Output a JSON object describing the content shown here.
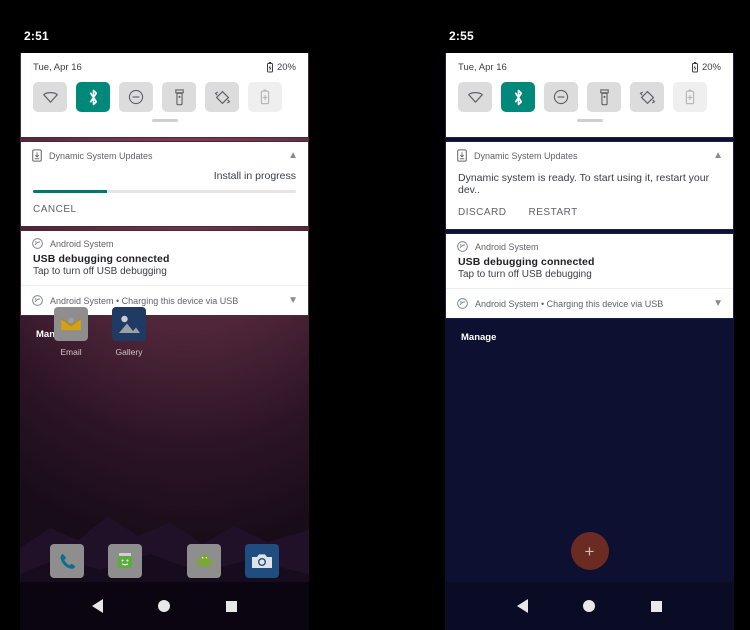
{
  "left": {
    "status": {
      "clock": "2:51"
    },
    "quick_settings": {
      "date": "Tue, Apr 16",
      "battery_percent": "20%",
      "battery_icon": "battery-icon",
      "tiles": [
        {
          "name": "wifi-tile",
          "icon": "wifi-icon",
          "state": "off"
        },
        {
          "name": "bluetooth-tile",
          "icon": "bluetooth-icon",
          "state": "on"
        },
        {
          "name": "do-not-disturb-tile",
          "icon": "dnd-icon",
          "state": "off"
        },
        {
          "name": "flashlight-tile",
          "icon": "flashlight-icon",
          "state": "off"
        },
        {
          "name": "auto-rotate-tile",
          "icon": "auto-rotate-icon",
          "state": "off"
        },
        {
          "name": "battery-saver-tile",
          "icon": "battery-saver-icon",
          "state": "disabled"
        }
      ]
    },
    "notifications": {
      "dsu": {
        "app": "Dynamic System Updates",
        "app_icon": "system-update-icon",
        "status_text": "Install in progress",
        "progress_percent": 28,
        "progress_color": "#00796b",
        "action_cancel": "CANCEL",
        "caret": "collapse-icon"
      },
      "usb_debug": {
        "app": "Android System",
        "app_icon": "android-system-icon",
        "title": "USB debugging connected",
        "text": "Tap to turn off USB debugging"
      },
      "charging": {
        "summary": "Android System • Charging this device via USB",
        "app_icon": "android-system-icon",
        "caret": "expand-icon"
      }
    },
    "manage_label": "Manage",
    "home": {
      "apps": [
        {
          "label": "Email",
          "icon": "email-icon"
        },
        {
          "label": "Gallery",
          "icon": "gallery-icon"
        }
      ],
      "dock": [
        {
          "label": "Phone",
          "icon": "phone-icon"
        },
        {
          "label": "Messages",
          "icon": "messages-icon"
        },
        {
          "label": "Android",
          "icon": "android-icon"
        },
        {
          "label": "Camera",
          "icon": "camera-icon"
        }
      ]
    },
    "navbar": {
      "back": "back-icon",
      "home": "home-icon",
      "recents": "recents-icon"
    }
  },
  "right": {
    "status": {
      "clock": "2:55"
    },
    "quick_settings": {
      "date": "Tue, Apr 16",
      "battery_percent": "20%",
      "battery_icon": "battery-icon",
      "tiles": [
        {
          "name": "wifi-tile",
          "icon": "wifi-icon",
          "state": "off"
        },
        {
          "name": "bluetooth-tile",
          "icon": "bluetooth-icon",
          "state": "on"
        },
        {
          "name": "do-not-disturb-tile",
          "icon": "dnd-icon",
          "state": "off"
        },
        {
          "name": "flashlight-tile",
          "icon": "flashlight-icon",
          "state": "off"
        },
        {
          "name": "auto-rotate-tile",
          "icon": "auto-rotate-icon",
          "state": "off"
        },
        {
          "name": "battery-saver-tile",
          "icon": "battery-saver-icon",
          "state": "disabled"
        }
      ]
    },
    "notifications": {
      "dsu": {
        "app": "Dynamic System Updates",
        "app_icon": "system-update-icon",
        "text": "Dynamic system is ready. To start using it, restart your dev..",
        "action_discard": "DISCARD",
        "action_restart": "RESTART",
        "caret": "collapse-icon"
      },
      "usb_debug": {
        "app": "Android System",
        "app_icon": "android-system-icon",
        "title": "USB debugging connected",
        "text": "Tap to turn off USB debugging"
      },
      "charging": {
        "summary": "Android System • Charging this device via USB",
        "app_icon": "android-system-icon",
        "caret": "expand-icon"
      }
    },
    "manage_label": "Manage",
    "fab": {
      "icon": "plus-icon",
      "label": "+",
      "color": "#6b2b22"
    },
    "navbar": {
      "back": "back-icon",
      "home": "home-icon",
      "recents": "recents-icon"
    }
  }
}
